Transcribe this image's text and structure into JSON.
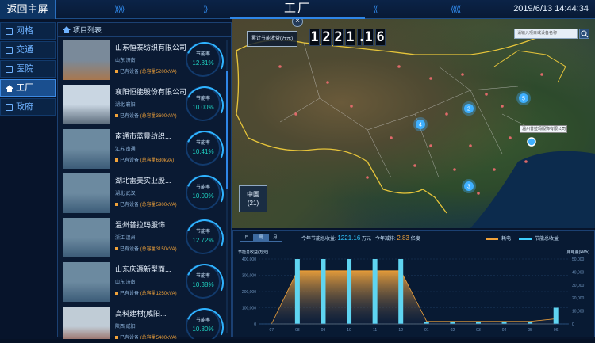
{
  "header": {
    "home_label": "返回主屏",
    "title": "工厂",
    "datetime": "2019/6/13 14:44:34"
  },
  "nav": {
    "items": [
      {
        "label": "网格",
        "icon": "square-icon",
        "active": false
      },
      {
        "label": "交通",
        "icon": "square-icon",
        "active": false
      },
      {
        "label": "医院",
        "icon": "square-icon",
        "active": false
      },
      {
        "label": "工厂",
        "icon": "home-icon",
        "active": true
      },
      {
        "label": "政府",
        "icon": "square-icon",
        "active": false
      }
    ]
  },
  "project_list": {
    "title": "项目列表",
    "gauge_label": "节能率",
    "capacity_prefix": "已有设备",
    "items": [
      {
        "name": "山东恒泰纺织有限公司",
        "location": "山东 济南",
        "capacity": "(总容量5200kVA)",
        "rate": "12.81%"
      },
      {
        "name": "襄阳恒能股份有限公司",
        "location": "湖北 襄阳",
        "capacity": "(总容量3600kVA)",
        "rate": "10.00%"
      },
      {
        "name": "南通市蓝景纺织...",
        "location": "江苏 南通",
        "capacity": "(总容量630kVA)",
        "rate": "10.41%"
      },
      {
        "name": "湖北雷美实业股...",
        "location": "湖北 武汉",
        "capacity": "(总容量5900kVA)",
        "rate": "10.00%"
      },
      {
        "name": "温州普拉玛服饰...",
        "location": "浙江 温州",
        "capacity": "(总容量3150kVA)",
        "rate": "12.72%"
      },
      {
        "name": "山东庆源新型面...",
        "location": "山东 济南",
        "capacity": "(总容量1250kVA)",
        "rate": "10.38%"
      },
      {
        "name": "高科建材(咸阳...",
        "location": "陕西 咸阳",
        "capacity": "(总容量5400kVA)",
        "rate": "10.80%"
      }
    ]
  },
  "map": {
    "total_label": "累计节能收益(万元)",
    "total_digits": [
      "1",
      "2",
      "2",
      "1",
      ".",
      "1",
      "6"
    ],
    "search_placeholder": "请输入项目或设备名称",
    "region_name": "中国",
    "region_count": "(21)",
    "tooltip": "温州普拉玛服饰有限公司",
    "close_symbol": "×",
    "clusters": [
      {
        "count": "2",
        "x": 298,
        "y": 113
      },
      {
        "count": "5",
        "x": 367,
        "y": 100
      },
      {
        "count": "4",
        "x": 237,
        "y": 133
      },
      {
        "count": "3",
        "x": 298,
        "y": 211
      }
    ]
  },
  "chart_panel": {
    "tabs": [
      "日",
      "周",
      "月"
    ],
    "summary": {
      "prefix": "今年节能总收益:",
      "value1": "1221.16",
      "unit1": "万元",
      "mid": "今年减排:",
      "value2": "2.83",
      "unit2": "亿度"
    },
    "legend": [
      {
        "name": "耗电",
        "color": "#f0a23a"
      },
      {
        "name": "节能总收益",
        "color": "#3fd0ff"
      }
    ],
    "left_axis_title": "节能总收益(万元)",
    "right_axis_title": "用电量(kWh)",
    "colors": {
      "bar": "#5fd4f0",
      "area": "#f0a23a"
    }
  },
  "chart_data": {
    "type": "bar",
    "categories": [
      "07",
      "08",
      "09",
      "10",
      "11",
      "12",
      "01",
      "02",
      "03",
      "04",
      "05",
      "06"
    ],
    "series": [
      {
        "name": "节能总收益",
        "values": [
          0,
          400000,
          400000,
          400000,
          400000,
          400000,
          10000,
          10000,
          10000,
          10000,
          10000,
          100000
        ]
      },
      {
        "name": "耗电",
        "values": [
          0,
          41000,
          41000,
          41000,
          41000,
          41000,
          2000,
          2000,
          2000,
          2000,
          2000,
          4000
        ]
      }
    ],
    "left_ticks": [
      "400,000",
      "300,000",
      "200,000",
      "100,000",
      "0"
    ],
    "right_ticks": [
      "50,000",
      "40,000",
      "30,000",
      "20,000",
      "10,000",
      "0"
    ],
    "ylim_left": [
      0,
      400000
    ],
    "ylim_right": [
      0,
      50000
    ],
    "grid": true
  }
}
